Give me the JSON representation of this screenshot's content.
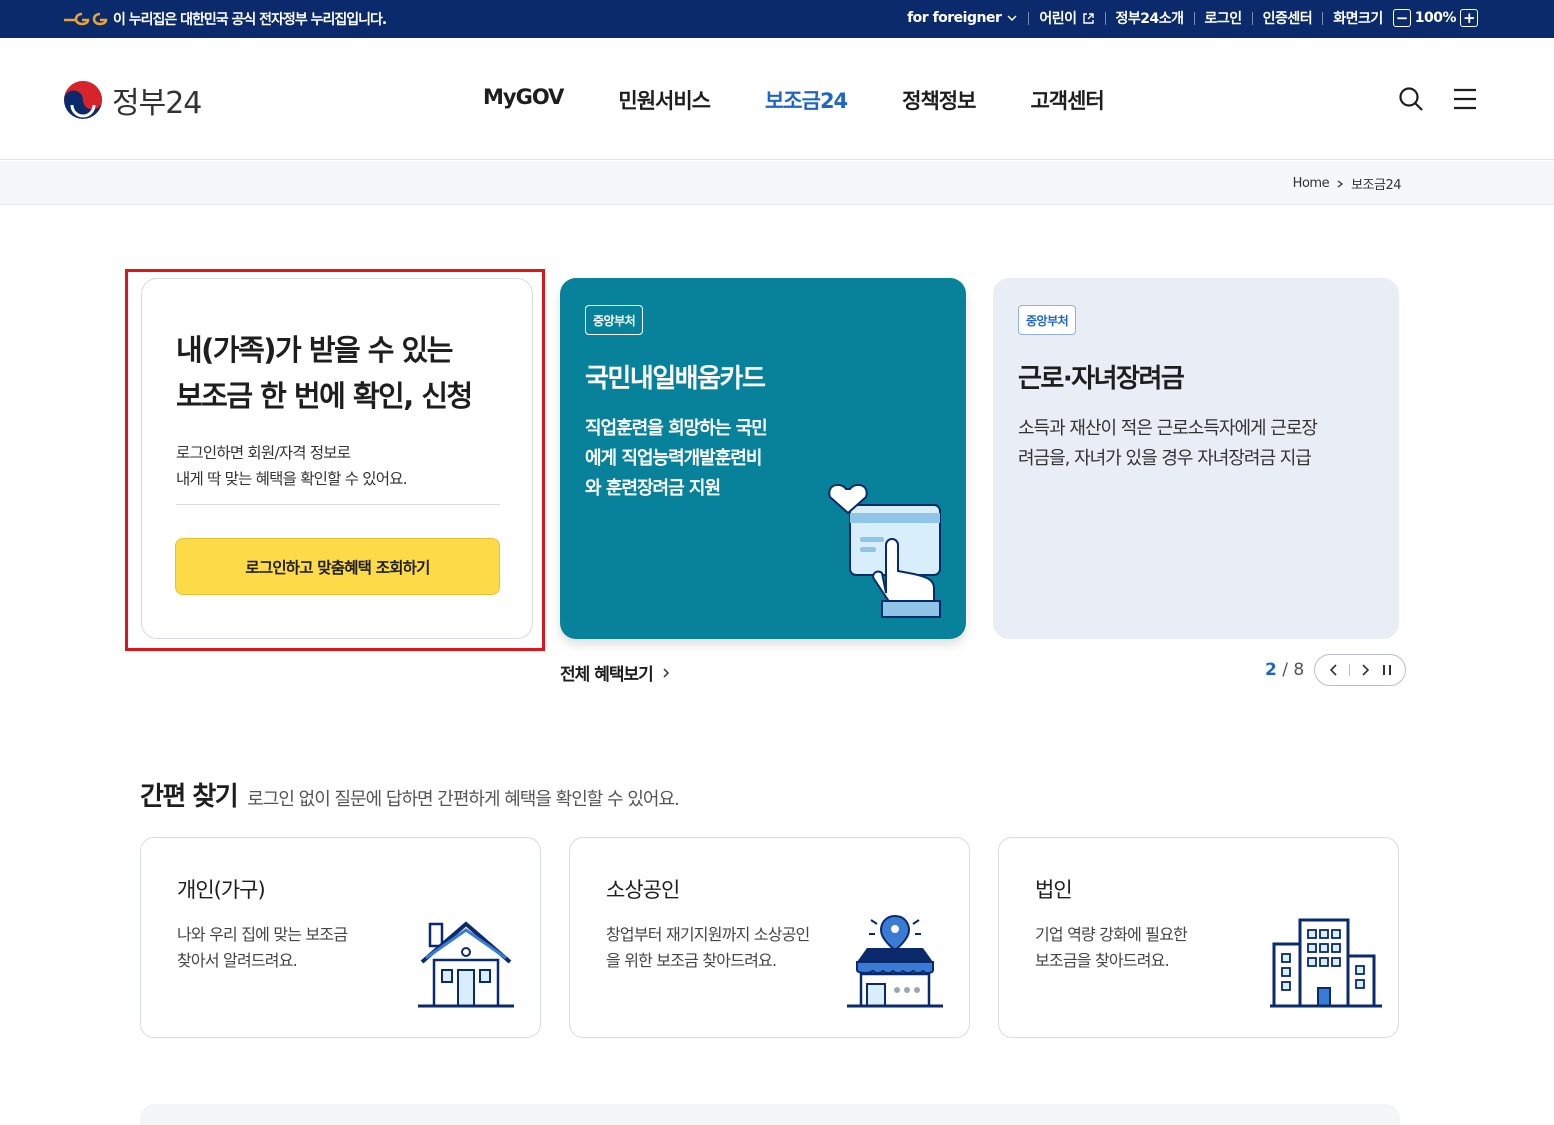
{
  "topbar": {
    "notice": "이 누리집은 대한민국 공식 전자정부 누리집입니다.",
    "for_foreigner": "for foreigner",
    "kids": "어린이",
    "about": "정부24소개",
    "login": "로그인",
    "cert": "인증센터",
    "screen_size": "화면크기",
    "zoom_minus": "−",
    "zoom_level": "100%",
    "zoom_plus": "+"
  },
  "header": {
    "logo": "정부24",
    "menu": [
      "MyGOV",
      "민원서비스",
      "보조금24",
      "정책정보",
      "고객센터"
    ],
    "active_menu": "보조금24"
  },
  "breadcrumb": {
    "home": "Home",
    "current": "보조금24"
  },
  "login_card": {
    "title_line1": "내(가족)가 받을 수 있는",
    "title_line2": "보조금 한 번에 확인, 신청",
    "desc_line1": "로그인하면 회원/자격 정보로",
    "desc_line2": "내게 딱 맞는 혜택을 확인할 수 있어요.",
    "button": "로그인하고 맞춤혜택 조회하기"
  },
  "benefits": [
    {
      "tag": "중앙부처",
      "title": "국민내일배움카드",
      "desc_lines": [
        "직업훈련을 희망하는 국민",
        "에게 직업능력개발훈련비",
        "와 훈련장려금 지원"
      ],
      "color": "#08829a"
    },
    {
      "tag": "중앙부처",
      "title": "근로·자녀장려금",
      "desc_lines": [
        "소득과 재산이 적은 근로소득자에게 근로장",
        "려금을, 자녀가 있을 경우 자녀장려금 지급"
      ],
      "color": "#e8edf6"
    }
  ],
  "carousel": {
    "all_view": "전체 혜택보기",
    "current": "2",
    "total": "8"
  },
  "quick": {
    "title": "간편 찾기",
    "subtitle": "로그인 없이 질문에 답하면 간편하게 혜택을 확인할 수 있어요.",
    "cards": [
      {
        "title": "개인(가구)",
        "desc_lines": [
          "나와 우리 집에 맞는 보조금",
          "찾아서 알려드려요."
        ],
        "icon": "house-icon"
      },
      {
        "title": "소상공인",
        "desc_lines": [
          "창업부터 재기지원까지 소상공인",
          "을 위한 보조금 찾아드려요."
        ],
        "icon": "store-icon"
      },
      {
        "title": "법인",
        "desc_lines": [
          "기업 역량 강화에 필요한",
          "보조금을 찾아드려요."
        ],
        "icon": "building-icon"
      }
    ]
  },
  "colors": {
    "navy": "#0b2a6b",
    "accent_blue": "#1f66c7",
    "cta_yellow": "#fddb48",
    "highlight_red": "#e0151b"
  }
}
